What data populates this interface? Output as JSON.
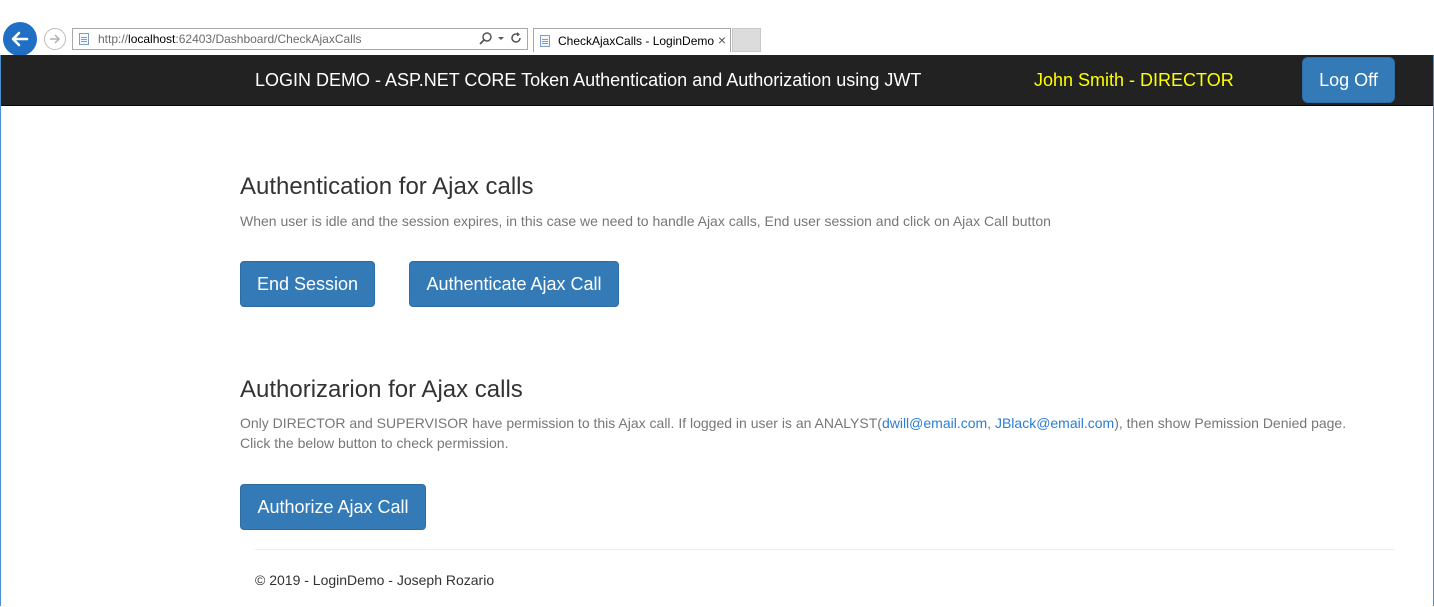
{
  "browser": {
    "url_prefix": "http://",
    "url_host": "localhost",
    "url_rest": ":62403/Dashboard/CheckAjaxCalls",
    "tab_title": "CheckAjaxCalls - LoginDemo",
    "tab_close": "×",
    "icons": [
      "back-arrow-icon",
      "forward-arrow-icon",
      "page-icon",
      "search-icon",
      "dropdown-icon",
      "refresh-icon",
      "close-icon"
    ]
  },
  "navbar": {
    "brand": "LOGIN DEMO - ASP.NET CORE Token Authentication and Authorization using JWT",
    "user": "John Smith - DIRECTOR",
    "logoff_label": "Log Off",
    "colors": {
      "background": "#222222",
      "user_text": "#ffff00",
      "button": "#337ab7"
    }
  },
  "authentication": {
    "title": "Authentication for Ajax calls",
    "description": "When user is idle and the session expires, in this case we need to handle Ajax calls, End user session and click on Ajax Call button",
    "end_session_label": "End Session",
    "authenticate_label": "Authenticate Ajax Call"
  },
  "authorization": {
    "title": "Authorizarion for Ajax calls",
    "desc_part1": "Only DIRECTOR and SUPERVISOR have permission to this Ajax call. If logged in user is an ANALYST(",
    "link1": "dwill@email.com",
    "sep": ", ",
    "link2": "JBlack@email.com",
    "desc_part2": "), then show Pemission Denied page.",
    "desc_line2": "Click the below button to check permission.",
    "authorize_label": "Authorize Ajax Call"
  },
  "footer": {
    "text": "© 2019 - LoginDemo - Joseph Rozario"
  }
}
